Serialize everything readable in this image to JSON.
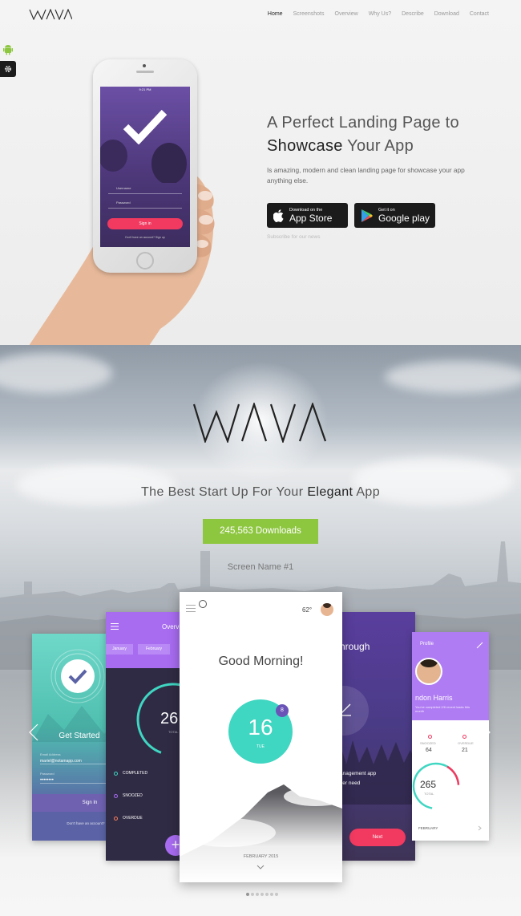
{
  "nav": {
    "items": [
      {
        "label": "Home",
        "active": true
      },
      {
        "label": "Screenshots",
        "active": false
      },
      {
        "label": "Overview",
        "active": false
      },
      {
        "label": "Why Us?",
        "active": false
      },
      {
        "label": "Describe",
        "active": false
      },
      {
        "label": "Download",
        "active": false
      },
      {
        "label": "Contact",
        "active": false
      }
    ]
  },
  "side_tools": [
    {
      "icon": "android-icon"
    },
    {
      "icon": "gear-icon"
    }
  ],
  "hero": {
    "title_line1": "A Perfect Landing Page to",
    "title_bold": "Showcase",
    "title_rest": " Your App",
    "description": "Is amazing, modern and clean landing page for showcase your app anything else.",
    "app_store": {
      "small": "Download on the",
      "big": "App Store"
    },
    "google_play": {
      "small": "Get it on",
      "big": "Google play"
    },
    "subscribe": "Subscribe for our news"
  },
  "phone": {
    "status": "9:21 PM",
    "username_placeholder": "Username",
    "password_placeholder": "Password",
    "signin": "Sign in",
    "footer": "Don't have an account? Sign up"
  },
  "showcase": {
    "tagline_pre": "The Best Start Up For Your ",
    "tagline_bold": "Elegant",
    "tagline_post": " App",
    "downloads": "245,563 Downloads",
    "screen_name": "Screen Name #1"
  },
  "cards": {
    "card1": {
      "title": "Get Started",
      "email": "mariel@notamapp.com",
      "password": "••••••••",
      "signin": "Sign In",
      "footer": "Don't have an account?",
      "email_label": "Email Address",
      "password_label": "Password"
    },
    "card2": {
      "title": "Overview",
      "tabs": [
        "January",
        "February"
      ],
      "number": "26",
      "number_label": "TOTAL",
      "rows": [
        "COMPLETED",
        "SNOOZED",
        "OVERDUE"
      ]
    },
    "card3": {
      "temp": "62°",
      "greeting": "Good Morning!",
      "day": "16",
      "weekday": "TUE",
      "badge": "8",
      "month": "FEBRUARY 2015"
    },
    "card4": {
      "title": "hrough",
      "desc_line1": "anagement app",
      "desc_line2": "ver need",
      "next": "Next"
    },
    "card5": {
      "title": "Profile",
      "name": "ndon Harris",
      "desc": "You've completed 2/6 recent tasks this month",
      "stat1_label": "SNOOZED",
      "stat1": "64",
      "stat2_label": "OVERDUE",
      "stat2": "21",
      "total": "265",
      "total_label": "TOTAL",
      "month": "FEBRUARY"
    }
  },
  "colors": {
    "accent_green": "#8dc63f",
    "accent_pink": "#f2395f",
    "teal": "#3fd6c2",
    "purple": "#a16bf2"
  }
}
